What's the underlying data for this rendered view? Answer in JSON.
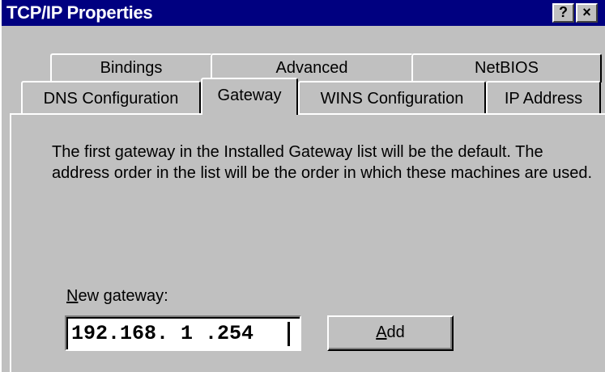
{
  "window": {
    "title": "TCP/IP Properties",
    "help_button": "?",
    "close_button": "×"
  },
  "tabs": {
    "row1": [
      {
        "label": "Bindings"
      },
      {
        "label": "Advanced"
      },
      {
        "label": "NetBIOS"
      }
    ],
    "row2": [
      {
        "label": "DNS Configuration"
      },
      {
        "label": "Gateway",
        "active": true
      },
      {
        "label": "WINS Configuration"
      },
      {
        "label": "IP Address"
      }
    ]
  },
  "gateway_panel": {
    "description": "The first gateway in the Installed Gateway list will be the default. The address order in the list will be the order in which these machines are used.",
    "new_gateway_label_prefix": "N",
    "new_gateway_label_rest": "ew gateway:",
    "new_gateway_value": "192.168. 1 .254",
    "add_button_prefix": "A",
    "add_button_rest": "dd"
  },
  "colors": {
    "title_bar": "#000080",
    "face": "#c0c0c0",
    "text": "#000000"
  }
}
